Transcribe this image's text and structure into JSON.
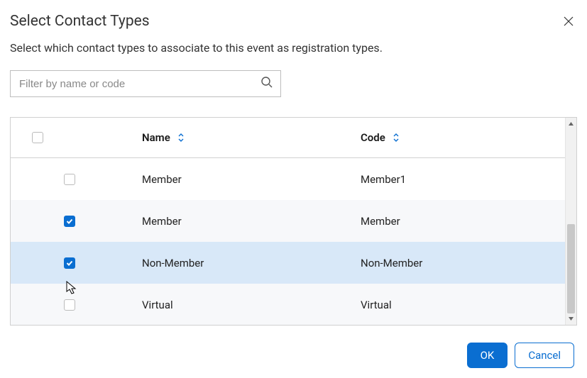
{
  "modal": {
    "title": "Select Contact Types",
    "subtitle": "Select which contact types to associate to this event as registration types."
  },
  "filter": {
    "placeholder": "Filter by name or code",
    "value": ""
  },
  "table": {
    "columns": {
      "name": "Name",
      "code": "Code"
    },
    "rows": [
      {
        "name": "Member",
        "code": "Member1",
        "checked": false,
        "alt": false,
        "selected": false
      },
      {
        "name": "Member",
        "code": "Member",
        "checked": true,
        "alt": true,
        "selected": false
      },
      {
        "name": "Non-Member",
        "code": "Non-Member",
        "checked": true,
        "alt": false,
        "selected": true
      },
      {
        "name": "Virtual",
        "code": "Virtual",
        "checked": false,
        "alt": true,
        "selected": false
      }
    ],
    "selectAllChecked": false
  },
  "footer": {
    "ok": "OK",
    "cancel": "Cancel"
  }
}
